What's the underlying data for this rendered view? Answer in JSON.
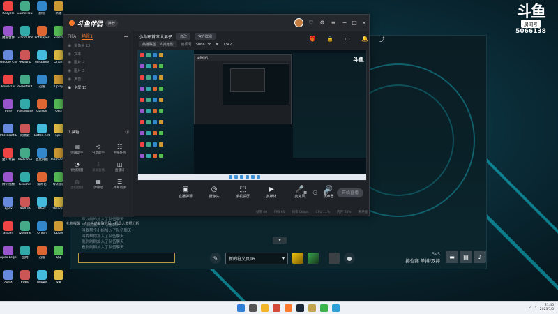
{
  "streaming_app": {
    "name": "斗鱼伴侣",
    "badge": "推荐",
    "scene_tabs": [
      "FIFA",
      "场景1"
    ],
    "scenes": [
      "摄像头 13",
      "文本",
      "图片 2",
      "图片 3",
      "声音 ...",
      "全屏 13"
    ],
    "tools_title": "工具箱",
    "tools": [
      {
        "label": "弹幕助手",
        "icon": "chat-icon",
        "dim": false
      },
      {
        "label": "分享助手",
        "icon": "share-icon",
        "dim": false
      },
      {
        "label": "主播任务",
        "icon": "task-icon",
        "dim": false
      },
      {
        "label": "视频流量",
        "icon": "video-icon",
        "dim": false
      },
      {
        "label": "录屏直播",
        "icon": "download-icon",
        "dim": true
      },
      {
        "label": "直播间",
        "icon": "room-icon",
        "dim": false
      },
      {
        "label": "虚拟直播",
        "icon": "virtual-icon",
        "dim": true
      },
      {
        "label": "弹幕墙",
        "icon": "wall-icon",
        "dim": false
      },
      {
        "label": "弹幕助手",
        "icon": "list-icon",
        "dim": false
      }
    ],
    "marquee": "礼物提醒  · 点击自动获取代码 · 机器人数据分析",
    "room_title": "小乌布首席大弟子",
    "room_btn1": "修改",
    "room_btn2": "官方群组",
    "category": "英雄联盟 · 人类暗影",
    "room_id_label": "房间号",
    "room_id": "5066138",
    "fans": "1342",
    "controls": [
      {
        "label": "直播弹幕",
        "icon": "dm-icon"
      },
      {
        "label": "摄像头",
        "icon": "camera-icon"
      },
      {
        "label": "手机投屏",
        "icon": "phone-icon"
      },
      {
        "label": "多媒体",
        "icon": "media-icon"
      },
      {
        "label": "麦克风",
        "icon": "mic-icon"
      },
      {
        "label": "扬声器",
        "icon": "speaker-icon"
      }
    ],
    "start_live": "开始直播",
    "status": [
      "帧率 60",
      "FPS 60",
      "码率 0kbps",
      "CPU 11%",
      "内存 28%",
      "未开播"
    ]
  },
  "game": {
    "logo_big": "斗鱼",
    "logo_room": "房间号",
    "logo_num": "5066138",
    "chat_log": [
      "写以前的加入了队伍聊天",
      "写以前加入了队伍聊天",
      "叫我帮个小姐加入了队伍聊天",
      "叫我帮你加入了队伍聊天",
      "刷刷刷刷加入了队伍聊天",
      "看刷刷刷加入了队伍聊天"
    ],
    "pack_selected": "新的符文页16",
    "vs": "5V5",
    "mode": "排位赛 单排/双排",
    "collapse": "▾"
  },
  "overlay_logo": {
    "big": "斗鱼",
    "room": "房间号",
    "num": "5066138"
  },
  "desktop_icons": [
    "Recycle",
    "GameHouse",
    "腾讯",
    "新建",
    "魔兽世界",
    "Grand Theft",
    "PotPlayer",
    "Steam",
    "Google Chrome",
    "英雄联盟",
    "WeGame",
    "Origin",
    "PowerDir",
    "Rockstar Games",
    "迅雷",
    "Uplay",
    "Pure",
    "FastStone",
    "Ubisoft",
    "OBS",
    "Microsoft Edge",
    "网易云",
    "Battle.net",
    "Epic",
    "金山毒霸",
    "WeGame",
    "百度网盘",
    "TeamViewer",
    "腾讯视频",
    "Genshin",
    "爱奇艺",
    "QQ音乐",
    "Apex",
    "NVIDIA",
    "Xbox",
    "Discord",
    "Steam",
    "反恐精英",
    "Origin",
    "Uplay",
    "Apex Legends",
    "战网",
    "迅雷",
    "QQ",
    "Apex",
    "PUBG",
    "Adobe",
    "设置"
  ],
  "clock": {
    "time": "21:45",
    "date": "2023/1/6"
  }
}
